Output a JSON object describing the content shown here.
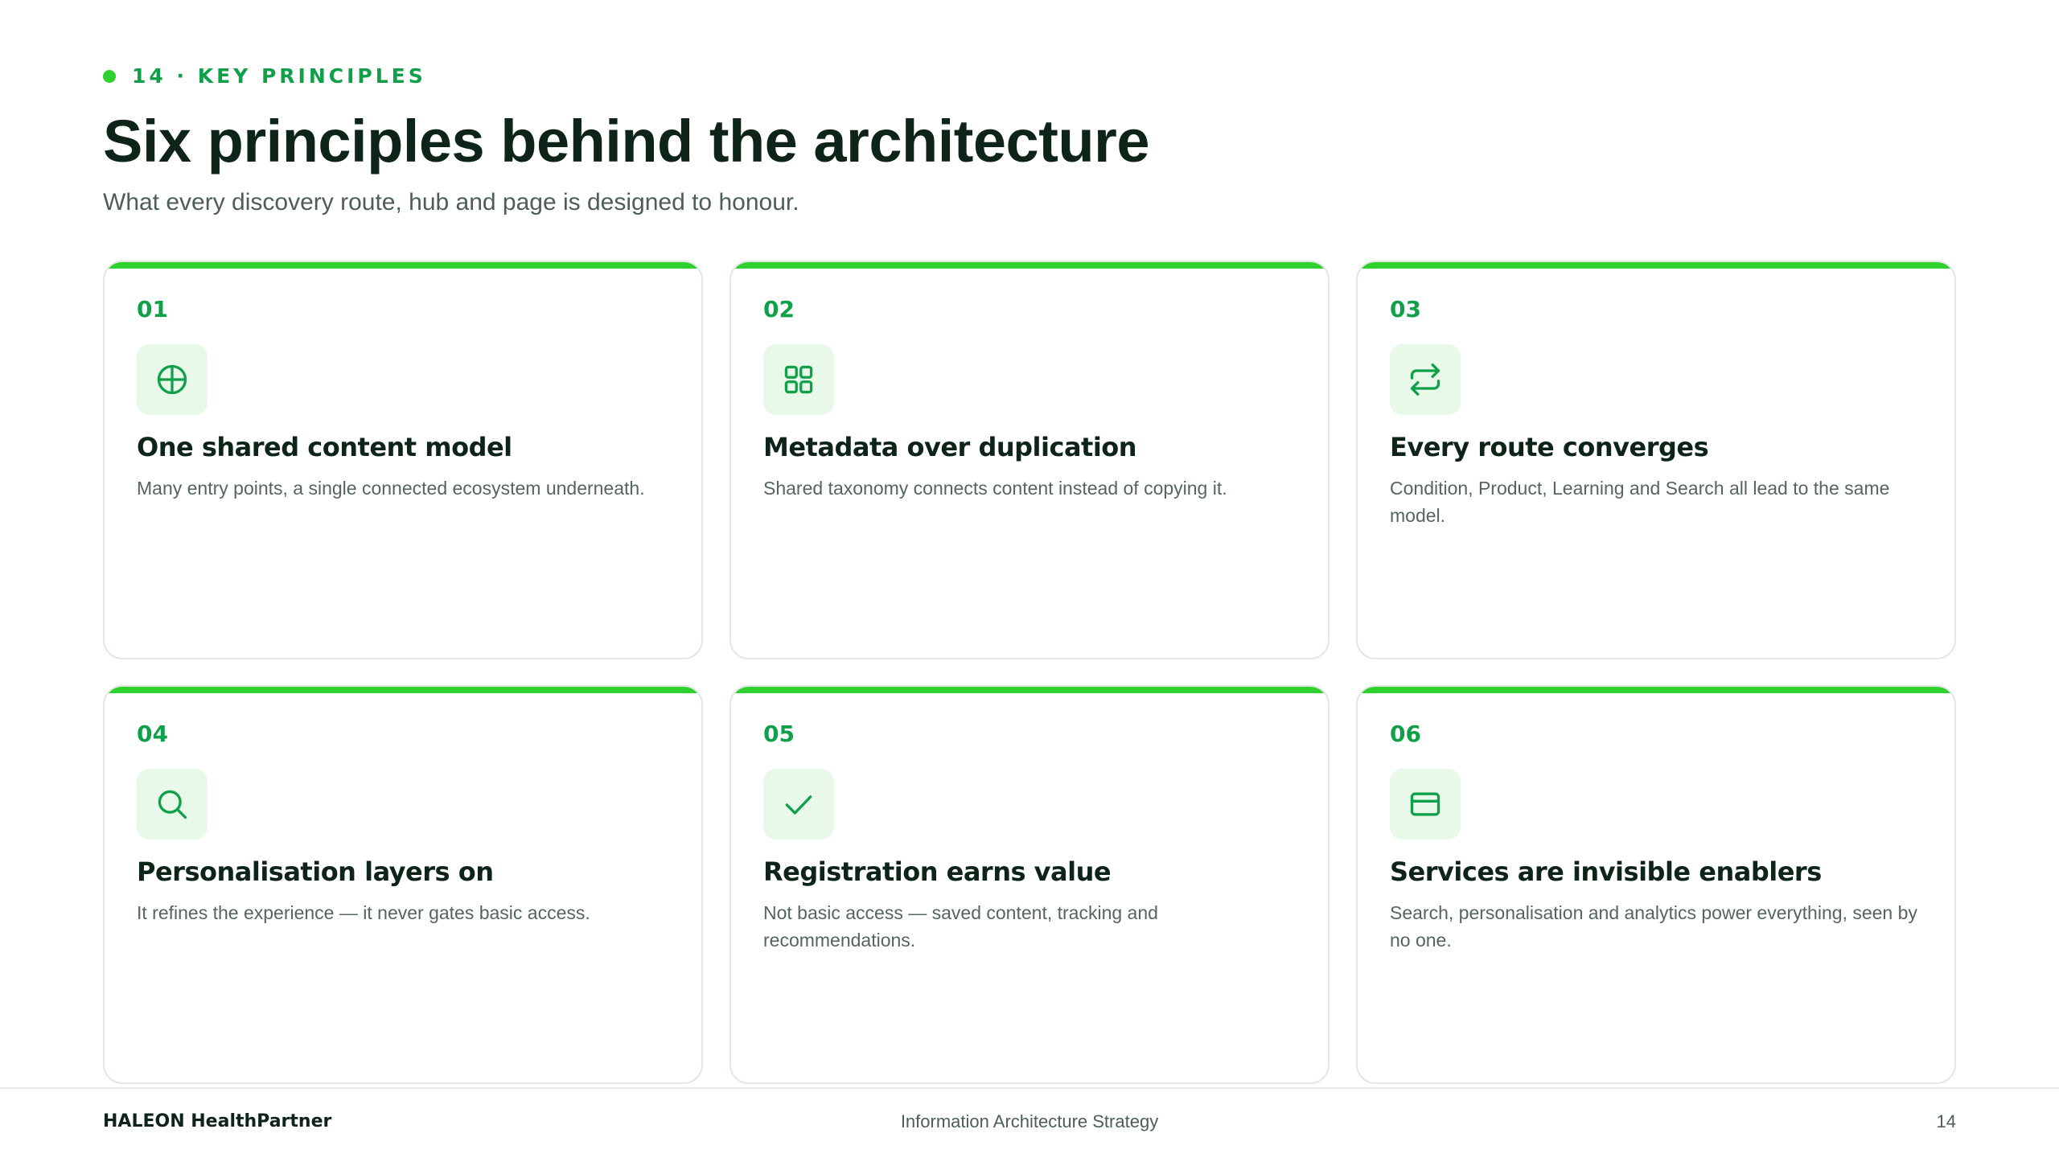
{
  "header": {
    "eyebrow": "14 · KEY PRINCIPLES",
    "title": "Six principles behind the architecture",
    "subtitle": "What every discovery route, hub and page is designed to honour."
  },
  "principles": [
    {
      "number": "01",
      "icon": "globe-icon",
      "title": "One shared content model",
      "description": "Many entry points, a single connected ecosystem underneath."
    },
    {
      "number": "02",
      "icon": "grid-icon",
      "title": "Metadata over duplication",
      "description": "Shared taxonomy connects content instead of copying it."
    },
    {
      "number": "03",
      "icon": "repeat-arrows-icon",
      "title": "Every route converges",
      "description": "Condition, Product, Learning and Search all lead to the same model."
    },
    {
      "number": "04",
      "icon": "search-icon",
      "title": "Personalisation layers on",
      "description": "It refines the experience — it never gates basic access."
    },
    {
      "number": "05",
      "icon": "check-icon",
      "title": "Registration earns value",
      "description": "Not basic access — saved content, tracking and recommendations."
    },
    {
      "number": "06",
      "icon": "card-icon",
      "title": "Services are invisible enablers",
      "description": "Search, personalisation and analytics power everything, seen by no one."
    }
  ],
  "footer": {
    "logo": "HALEON HealthPartner",
    "center": "Information Architecture Strategy",
    "page": "14"
  },
  "colors": {
    "accent": "#2fd12f",
    "brand_green": "#10a04a",
    "icon_bg": "#e8f8e9",
    "text_dark": "#0f2419",
    "text_muted": "#56655d",
    "border": "#e3e8e5"
  }
}
